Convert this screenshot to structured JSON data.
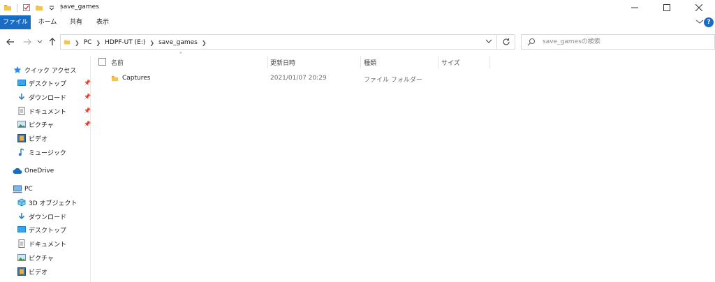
{
  "window": {
    "title": "save_games"
  },
  "ribbon": {
    "tabs": [
      {
        "label": "ファイル"
      },
      {
        "label": "ホーム"
      },
      {
        "label": "共有"
      },
      {
        "label": "表示"
      }
    ],
    "help_label": "?"
  },
  "address": {
    "crumbs": [
      "PC",
      "HDPF-UT (E:)",
      "save_games"
    ]
  },
  "search": {
    "placeholder": "save_gamesの検索"
  },
  "sidebar": {
    "quick_access": "クイック アクセス",
    "quick_items": [
      {
        "label": "デスクトップ",
        "icon": "desktop-icon"
      },
      {
        "label": "ダウンロード",
        "icon": "download-icon"
      },
      {
        "label": "ドキュメント",
        "icon": "document-icon"
      },
      {
        "label": "ピクチャ",
        "icon": "picture-icon"
      },
      {
        "label": "ビデオ",
        "icon": "video-icon"
      },
      {
        "label": "ミュージック",
        "icon": "music-icon"
      }
    ],
    "onedrive": "OneDrive",
    "pc": "PC",
    "pc_items": [
      {
        "label": "3D オブジェクト",
        "icon": "3d-objects-icon"
      },
      {
        "label": "ダウンロード",
        "icon": "download-icon"
      },
      {
        "label": "デスクトップ",
        "icon": "desktop-icon"
      },
      {
        "label": "ドキュメント",
        "icon": "document-icon"
      },
      {
        "label": "ピクチャ",
        "icon": "picture-icon"
      },
      {
        "label": "ビデオ",
        "icon": "video-icon"
      }
    ]
  },
  "columns": {
    "name": "名前",
    "modified": "更新日時",
    "type": "種類",
    "size": "サイズ"
  },
  "files": [
    {
      "name": "Captures",
      "modified": "2021/01/07 20:29",
      "type": "ファイル フォルダー",
      "size": ""
    }
  ],
  "colors": {
    "accent": "#1a6cc2",
    "folder": "#f4c44e"
  }
}
